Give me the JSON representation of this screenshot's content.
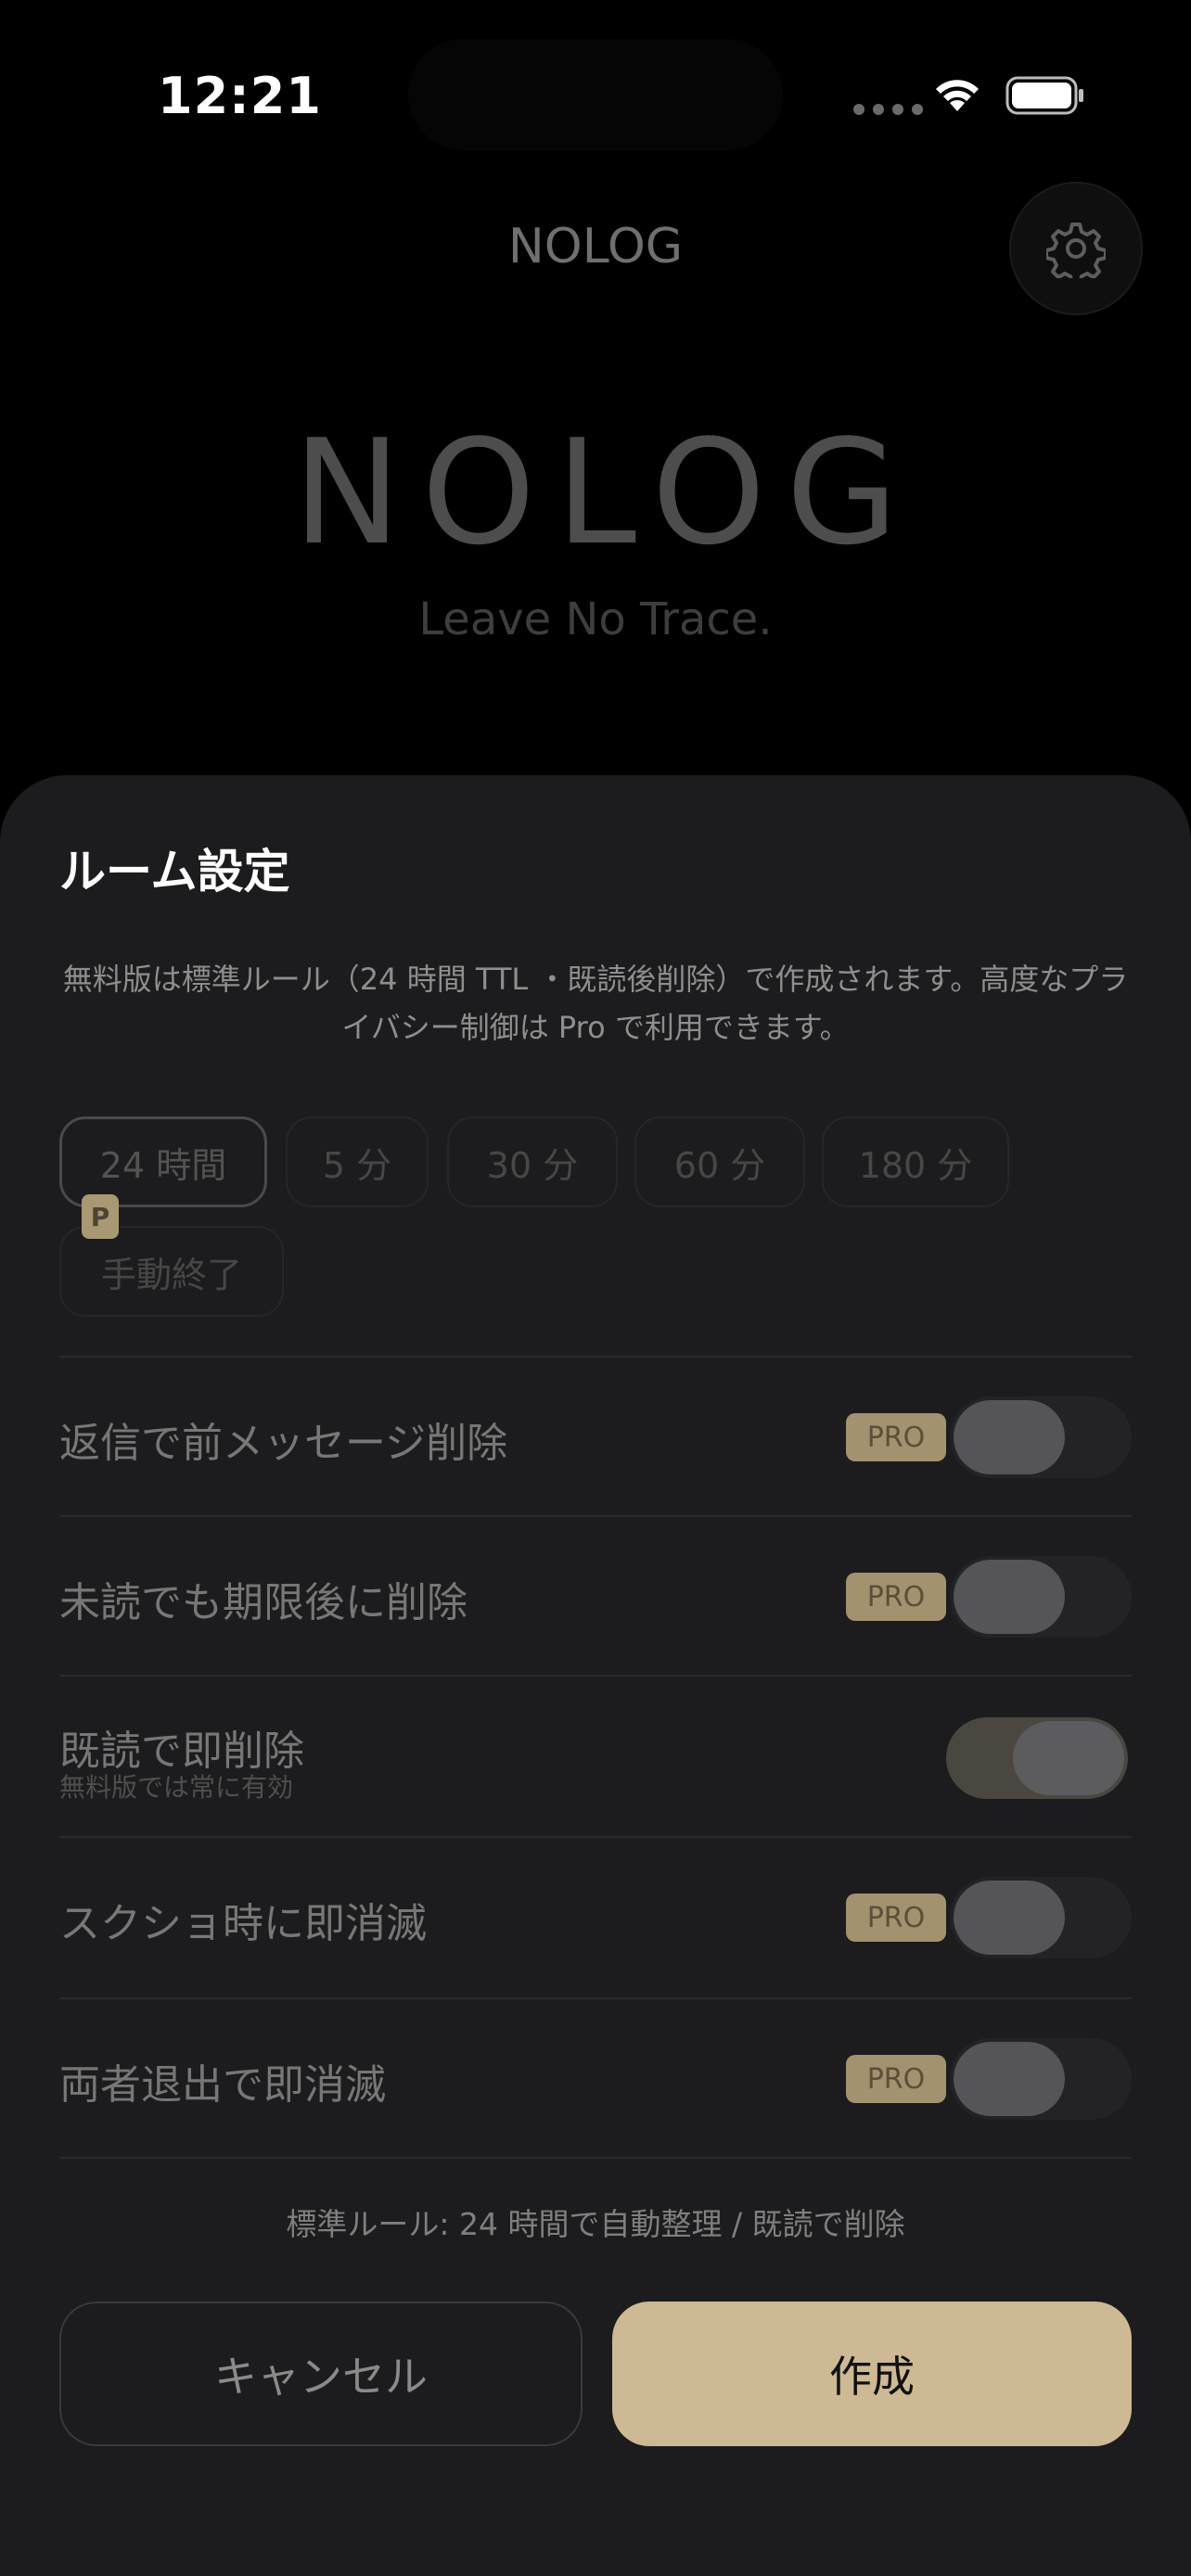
{
  "status_bar": {
    "time": "12:21"
  },
  "header": {
    "app_name": "NOLOG"
  },
  "hero": {
    "logo": "NOLOG",
    "tagline": "Leave No Trace."
  },
  "sheet": {
    "title": "ルーム設定",
    "description": "無料版は標準ルール（24 時間 TTL ・既読後削除）で作成されます。高度なプライバシー制御は Pro で利用できます。",
    "ttl_options": [
      {
        "label": "24 時間",
        "selected": true
      },
      {
        "label": "5 分"
      },
      {
        "label": "30 分"
      },
      {
        "label": "60 分"
      },
      {
        "label": "180 分"
      },
      {
        "label": "手動終了"
      }
    ],
    "pro_mini_label": "P",
    "options": [
      {
        "label": "返信で前メッセージ削除",
        "badge": "PRO",
        "enabled": false
      },
      {
        "label": "未読でも期限後に削除",
        "badge": "PRO",
        "enabled": false
      },
      {
        "label": "既読で即削除",
        "sub": "無料版では常に有効",
        "enabled": true
      },
      {
        "label": "スクショ時に即消滅",
        "badge": "PRO",
        "enabled": false
      },
      {
        "label": "両者退出で即消滅",
        "badge": "PRO",
        "enabled": false
      }
    ],
    "footer_note": "標準ルール: 24 時間で自動整理 / 既読で削除",
    "cancel_label": "キャンセル",
    "create_label": "作成"
  },
  "colors": {
    "accent": "#cdb994",
    "pro_badge": "#a39270",
    "sheet_background": "#1c1c1e",
    "background": "#000000"
  },
  "icons": {
    "settings": "gear-icon",
    "wifi": "wifi-icon",
    "battery": "battery-icon"
  }
}
